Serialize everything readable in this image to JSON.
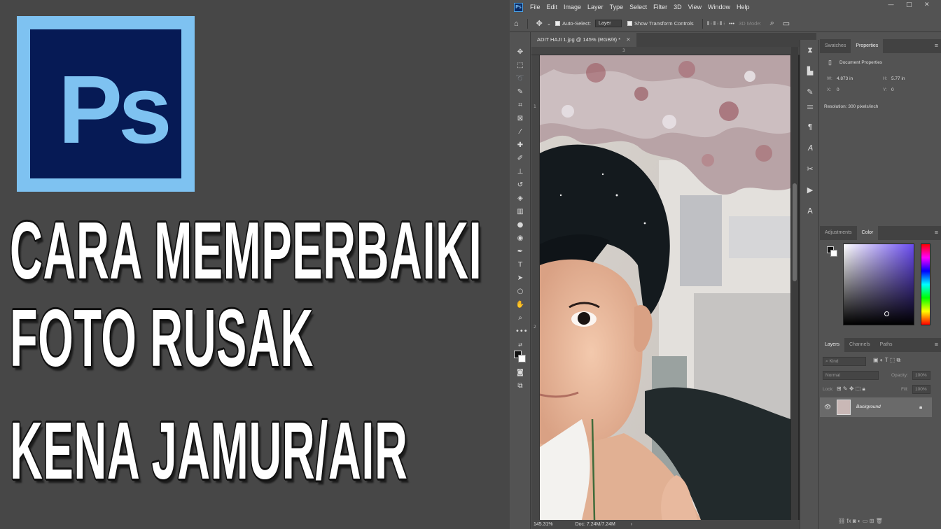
{
  "headline": {
    "line1": "CARA MEMPERBAIKI",
    "line2": "FOTO RUSAK",
    "line3": "KENA JAMUR/AIR"
  },
  "logo": {
    "text": "Ps"
  },
  "menubar": {
    "items": [
      "File",
      "Edit",
      "Image",
      "Layer",
      "Type",
      "Select",
      "Filter",
      "3D",
      "View",
      "Window",
      "Help"
    ]
  },
  "options": {
    "auto_select": "Auto-Select:",
    "auto_select_value": "Layer",
    "transform": "Show Transform Controls",
    "mode3d": "3D Mode:"
  },
  "document": {
    "tab": "ADIT HAJI 1.jpg @ 145% (RGB/8) *",
    "zoom": "145.31%",
    "doc_size": "Doc: 7.24M/7.24M",
    "ruler_top": "3",
    "ruler_left_1": "1",
    "ruler_left_2": "2"
  },
  "properties": {
    "tabs": [
      "Swatches",
      "Properties"
    ],
    "header": "Document Properties",
    "w_label": "W:",
    "w_value": "4.873 in",
    "h_label": "H:",
    "h_value": "5.77 in",
    "x_label": "X:",
    "x_value": "0",
    "y_label": "Y:",
    "y_value": "0",
    "resolution": "Resolution: 300 pixels/inch"
  },
  "color_panel": {
    "tabs": [
      "Adjustments",
      "Color"
    ]
  },
  "layers_panel": {
    "tabs": [
      "Layers",
      "Channels",
      "Paths"
    ],
    "kind": "Kind",
    "blend": "Normal",
    "opacity_label": "Opacity:",
    "opacity_value": "100%",
    "lock_label": "Lock:",
    "fill_label": "Fill:",
    "fill_value": "100%",
    "layer_name": "Background"
  },
  "colors": {
    "ps_blue": "#7ec2f1",
    "ps_navy": "#061a55",
    "ui_gray": "#535353"
  }
}
